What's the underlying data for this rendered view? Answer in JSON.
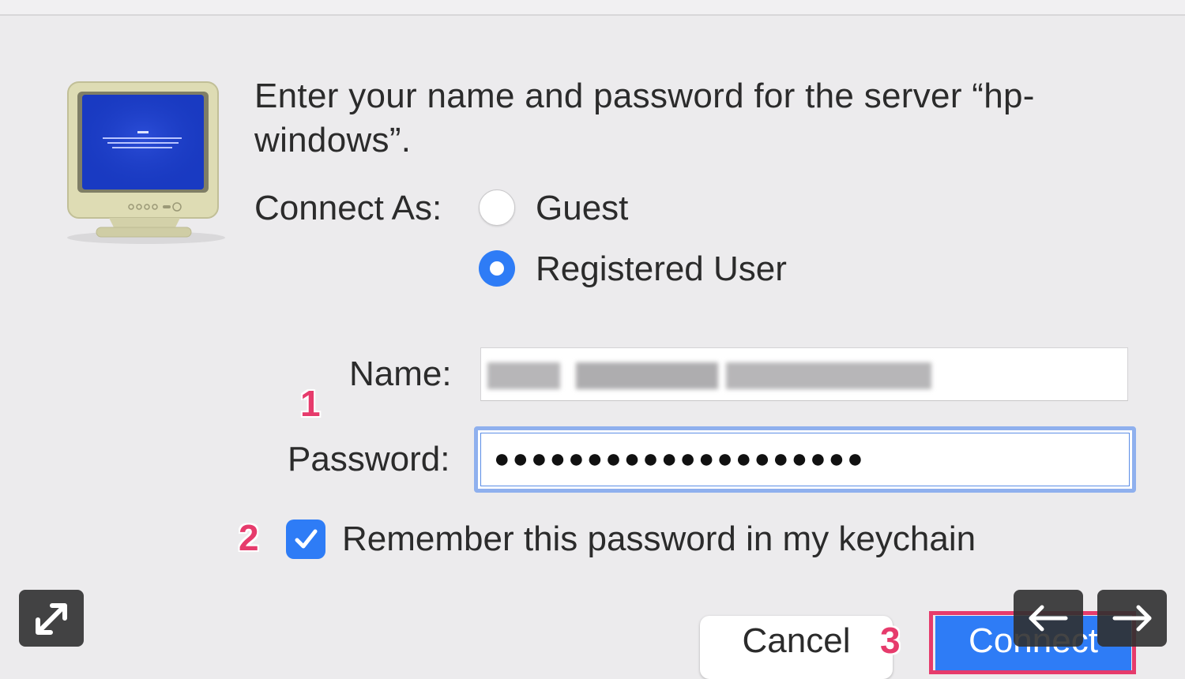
{
  "dialog": {
    "heading": "Enter your name and password for the server “hp-windows”.",
    "connect_as_label": "Connect As:",
    "options": {
      "guest": {
        "label": "Guest",
        "selected": false
      },
      "registered": {
        "label": "Registered User",
        "selected": true
      }
    },
    "name_label": "Name:",
    "password_label": "Password:",
    "password_value": "●●●●●●●●●●●●●●●●●●●●",
    "remember_label": "Remember this password in my keychain",
    "remember_checked": true,
    "cancel_label": "Cancel",
    "connect_label": "Connect"
  },
  "annotations": {
    "step1": "1",
    "step2": "2",
    "step3": "3"
  },
  "icons": {
    "monitor": "monitor-icon",
    "expand": "expand-icon",
    "prev": "arrow-left-icon",
    "next": "arrow-right-icon",
    "check": "checkmark-icon"
  },
  "colors": {
    "accent": "#2e7cf6",
    "annotation": "#e63b6c",
    "focus_ring": "#8fb0ee",
    "background": "#ecebed"
  }
}
